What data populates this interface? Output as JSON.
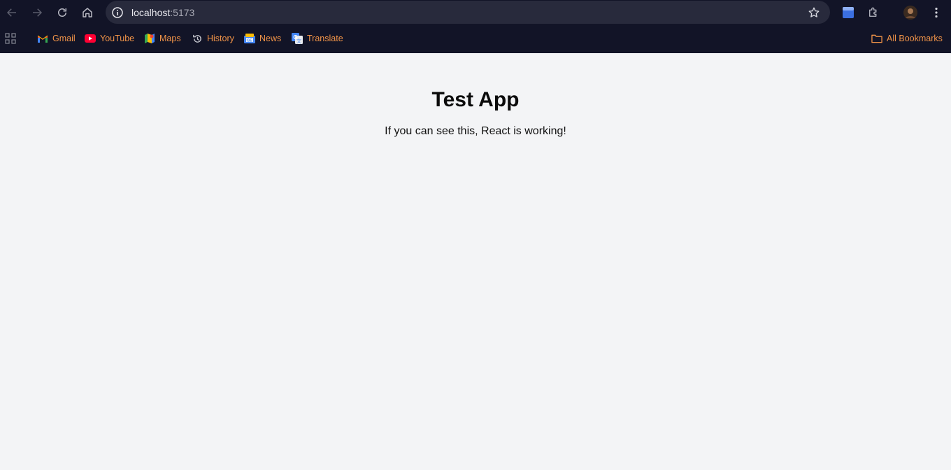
{
  "browser": {
    "url_host": "localhost",
    "url_port": ":5173",
    "bookmarks": [
      {
        "label": "Gmail",
        "icon": "gmail-icon"
      },
      {
        "label": "YouTube",
        "icon": "youtube-icon"
      },
      {
        "label": "Maps",
        "icon": "maps-icon"
      },
      {
        "label": "History",
        "icon": "history-icon"
      },
      {
        "label": "News",
        "icon": "news-icon"
      },
      {
        "label": "Translate",
        "icon": "translate-icon"
      }
    ],
    "all_bookmarks_label": "All Bookmarks",
    "accent_color": "#f09348",
    "chrome_bg": "#121427"
  },
  "page": {
    "title": "Test App",
    "message": "If you can see this, React is working!",
    "bg": "#f3f4f6"
  }
}
